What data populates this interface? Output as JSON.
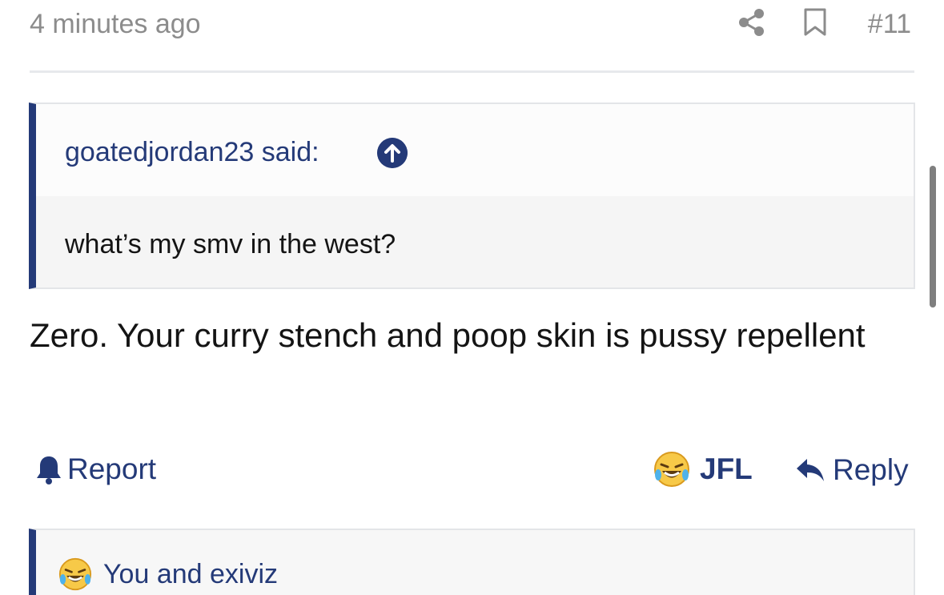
{
  "post": {
    "timestamp": "4 minutes ago",
    "number": "#11",
    "icons": {
      "share": "share-icon",
      "bookmark": "bookmark-icon"
    },
    "quote": {
      "author_line": "goatedjordan23 said:",
      "text": "what’s my smv in the west?",
      "jump_icon": "arrow-up-icon"
    },
    "body": "Zero. Your curry stench and poop skin is pussy repellent",
    "actions": {
      "report_label": "Report",
      "reaction_label": "JFL",
      "reply_label": "Reply"
    },
    "reactions_summary": "You and exiviz"
  },
  "colors": {
    "accent": "#243a78",
    "muted_text": "#8c8c8c",
    "quote_bg": "#f5f5f5"
  }
}
